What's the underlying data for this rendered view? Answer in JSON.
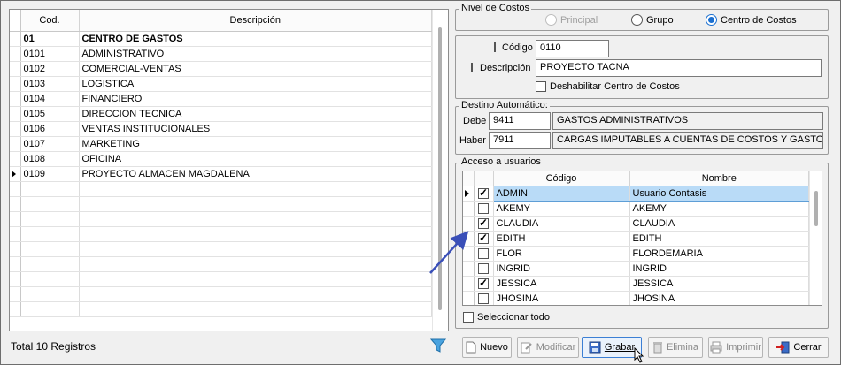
{
  "left_grid": {
    "columns": [
      "Cod.",
      "Descripción"
    ],
    "rows": [
      {
        "code": "01",
        "desc": "CENTRO DE GASTOS"
      },
      {
        "code": "0101",
        "desc": "ADMINISTRATIVO"
      },
      {
        "code": "0102",
        "desc": "COMERCIAL-VENTAS"
      },
      {
        "code": "0103",
        "desc": "LOGISTICA"
      },
      {
        "code": "0104",
        "desc": "FINANCIERO"
      },
      {
        "code": "0105",
        "desc": "DIRECCION TECNICA"
      },
      {
        "code": "0106",
        "desc": "VENTAS INSTITUCIONALES"
      },
      {
        "code": "0107",
        "desc": "MARKETING"
      },
      {
        "code": "0108",
        "desc": "OFICINA"
      },
      {
        "code": "0109",
        "desc": "PROYECTO ALMACEN MAGDALENA"
      }
    ],
    "total_label": "Total 10 Registros"
  },
  "nivel": {
    "title": "Nivel de Costos",
    "options": [
      "Principal",
      "Grupo",
      "Centro de Costos"
    ],
    "selected": "Centro de Costos"
  },
  "detalle": {
    "codigo_label": "Código",
    "codigo_value": "0110",
    "descripcion_label": "Descripción",
    "descripcion_value": "PROYECTO TACNA",
    "deshabilitar_label": "Deshabilitar Centro de Costos"
  },
  "destino": {
    "title": "Destino Automático:",
    "debe_label": "Debe",
    "debe_code": "9411",
    "debe_desc": "GASTOS ADMINISTRATIVOS",
    "haber_label": "Haber",
    "haber_code": "7911",
    "haber_desc": "CARGAS IMPUTABLES A CUENTAS DE COSTOS Y GASTOS"
  },
  "acceso": {
    "title": "Acceso a usuarios",
    "columns": [
      "Código",
      "Nombre"
    ],
    "users": [
      {
        "code": "ADMIN",
        "name": "Usuario Contasis",
        "checked": true
      },
      {
        "code": "AKEMY",
        "name": "AKEMY",
        "checked": false
      },
      {
        "code": "CLAUDIA",
        "name": "CLAUDIA",
        "checked": true
      },
      {
        "code": "EDITH",
        "name": "EDITH",
        "checked": true
      },
      {
        "code": "FLOR",
        "name": "FLORDEMARIA",
        "checked": false
      },
      {
        "code": "INGRID",
        "name": "INGRID",
        "checked": false
      },
      {
        "code": "JESSICA",
        "name": "JESSICA",
        "checked": true
      },
      {
        "code": "JHOSINA",
        "name": "JHOSINA",
        "checked": false
      }
    ],
    "select_all_label": "Seleccionar todo"
  },
  "toolbar": {
    "nuevo": "Nuevo",
    "modificar": "Modificar",
    "grabar": "Grabar",
    "elimina": "Elimina",
    "imprimir": "Imprimir",
    "cerrar": "Cerrar"
  },
  "icons": [
    "filter-icon",
    "new-document-icon",
    "edit-icon",
    "save-icon",
    "delete-icon",
    "printer-icon",
    "exit-icon",
    "mouse-cursor-icon"
  ]
}
